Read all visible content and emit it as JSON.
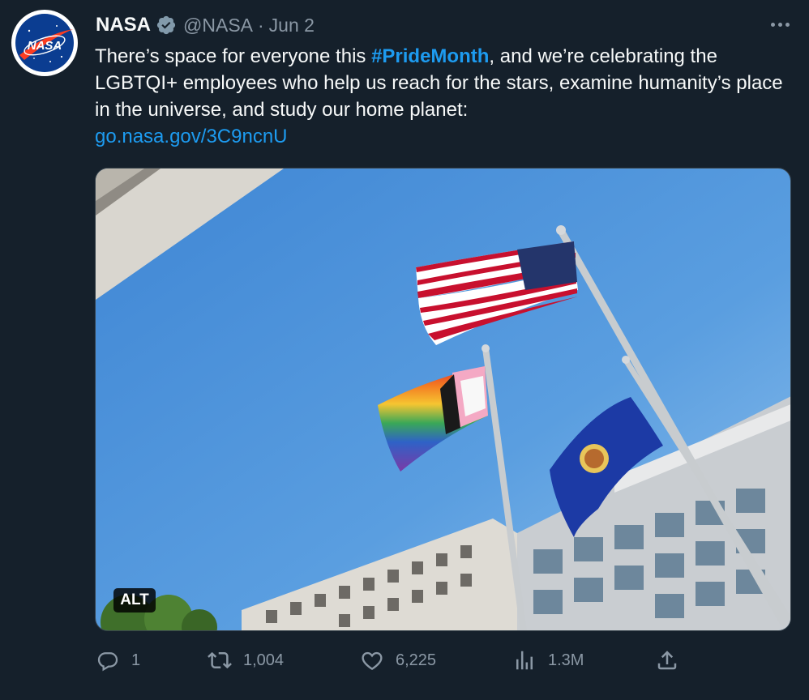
{
  "tweet": {
    "author": {
      "name": "NASA",
      "handle": "@NASA",
      "separator": "·",
      "date": "Jun 2",
      "avatar_text": "NASA"
    },
    "text": {
      "part1": "There’s space for everyone this ",
      "hashtag": "#PrideMonth",
      "part2": ", and we’re celebrating the LGBTQI+ employees who help us reach for the stars, examine humanity’s place in the universe, and study our home planet:",
      "link": "go.nasa.gov/3C9ncnU"
    },
    "media": {
      "alt_badge": "ALT"
    },
    "actions": {
      "replies": "1",
      "retweets": "1,004",
      "likes": "6,225",
      "views": "1.3M"
    },
    "icons": {
      "more": "more-dots-icon",
      "verified": "verified-badge-icon",
      "reply": "reply-icon",
      "retweet": "retweet-icon",
      "like": "heart-icon",
      "views": "views-bar-icon",
      "share": "share-icon"
    },
    "colors": {
      "background": "#15202b",
      "accent": "#1d9bf0",
      "muted": "#8b98a5",
      "text": "#f7f9f9"
    }
  }
}
